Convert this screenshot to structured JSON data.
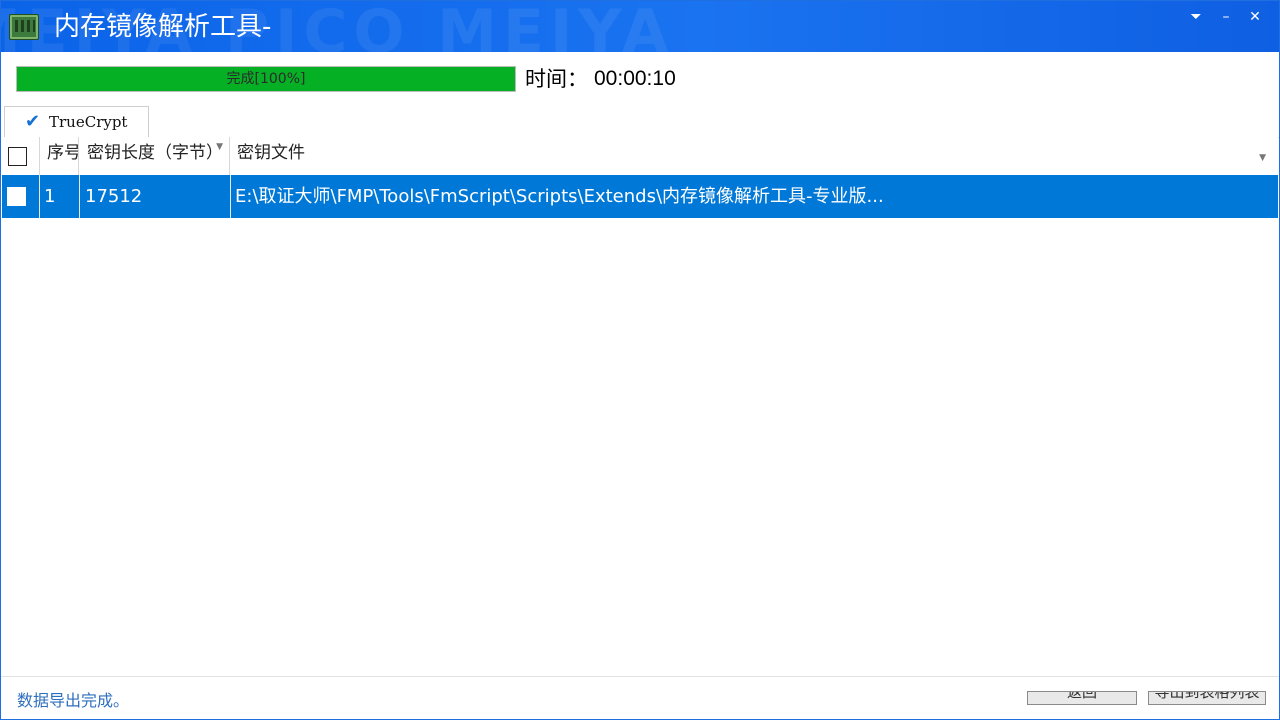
{
  "window": {
    "title": "内存镜像解析工具-",
    "title_watermark": "MEIYA PICO MEIYA",
    "controls": {
      "menu": "⏷",
      "minimize": "–",
      "close": "✕"
    }
  },
  "progress": {
    "label": "完成[100%]",
    "value": 100,
    "fill_color": "#06b025"
  },
  "time": {
    "label": "时间：",
    "value": "00:00:10"
  },
  "tabs": [
    {
      "label": "TrueCrypt",
      "icon": "check-icon"
    }
  ],
  "table": {
    "headers": [
      "序号",
      "密钥长度（字节）",
      "密钥文件"
    ],
    "rows": [
      {
        "index": "1",
        "key_length": "17512",
        "key_file": "E:\\取证大师\\FMP\\Tools\\FmScript\\Scripts\\Extends\\内存镜像解析工具-专业版..."
      }
    ],
    "selected_color": "#0078d7"
  },
  "status": {
    "message": "数据导出完成。"
  },
  "buttons": {
    "back": "返回",
    "export": "导出到表格列表"
  }
}
